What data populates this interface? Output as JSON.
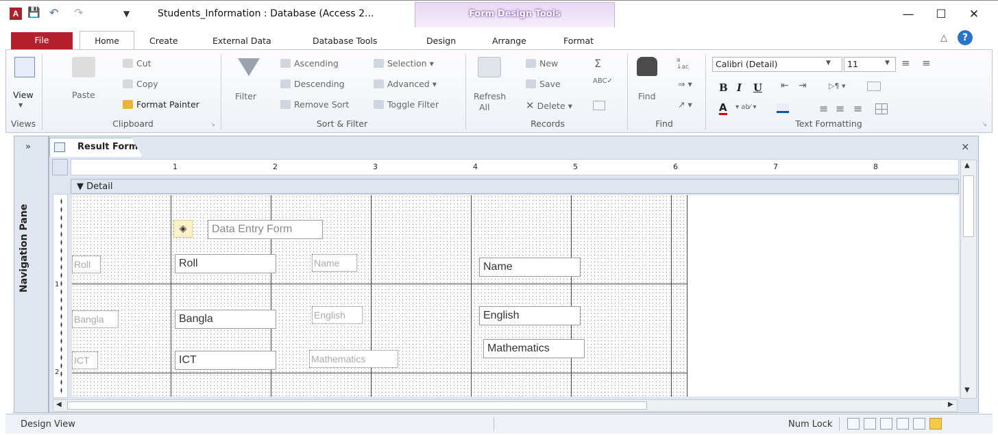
{
  "title": {
    "doc_title": "Students_Information : Database (Access 2...",
    "context_tab": "Form Design Tools",
    "minimize": "—",
    "maximize": "☐",
    "close": "✕"
  },
  "tabs": {
    "file": "File",
    "home": "Home",
    "create": "Create",
    "external_data": "External Data",
    "database_tools": "Database Tools",
    "design": "Design",
    "arrange": "Arrange",
    "format": "Format"
  },
  "ribbon": {
    "views": {
      "view": "View",
      "group": "Views"
    },
    "clipboard": {
      "paste": "Paste",
      "cut": "Cut",
      "copy": "Copy",
      "format_painter": "Format Painter",
      "group": "Clipboard"
    },
    "sort_filter": {
      "filter": "Filter",
      "ascending": "Ascending",
      "descending": "Descending",
      "remove_sort": "Remove Sort",
      "selection": "Selection",
      "advanced": "Advanced",
      "toggle_filter": "Toggle Filter",
      "group": "Sort & Filter"
    },
    "records": {
      "refresh": "Refresh",
      "refresh_all": "All",
      "new": "New",
      "save": "Save",
      "delete": "Delete",
      "group": "Records"
    },
    "find": {
      "find": "Find",
      "group": "Find"
    },
    "text_formatting": {
      "font": "Calibri (Detail)",
      "size": "11",
      "group": "Text Formatting"
    }
  },
  "nav_pane": {
    "label": "Navigation Pane",
    "toggle": "»"
  },
  "document": {
    "tab_label": "Result Form",
    "close": "×",
    "section": "Detail",
    "ruler_numbers": [
      "1",
      "2",
      "3",
      "4",
      "5",
      "6",
      "7",
      "8"
    ],
    "vruler_numbers": [
      "1",
      "2"
    ]
  },
  "form": {
    "title_label": "Data Entry Form",
    "labels": {
      "roll": "Roll",
      "name": "Name",
      "bangla": "Bangla",
      "english": "English",
      "ict": "ICT",
      "mathematics": "Mathematics"
    },
    "fields": {
      "roll": "Roll",
      "name": "Name",
      "bangla": "Bangla",
      "english": "English",
      "ict": "ICT",
      "mathematics": "Mathematics"
    }
  },
  "status": {
    "view": "Design View",
    "num_lock": "Num Lock"
  }
}
